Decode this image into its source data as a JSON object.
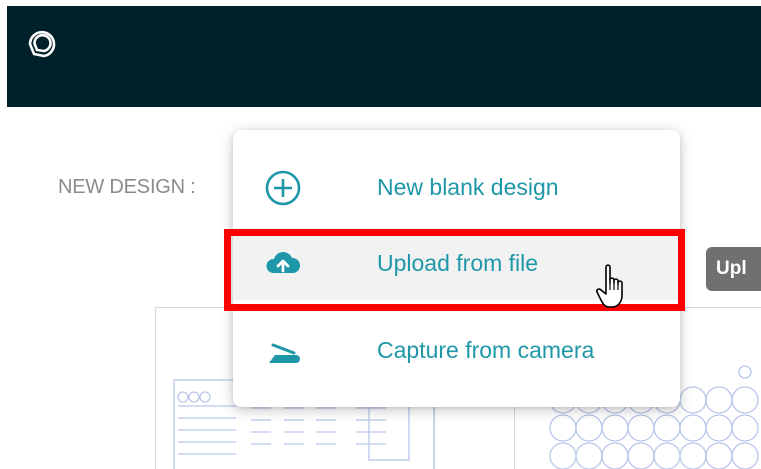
{
  "header": {
    "logo_icon": "pin-logo-icon"
  },
  "new_design": {
    "label": "NEW DESIGN :"
  },
  "side_chip": {
    "label": "Upl"
  },
  "menu": {
    "items": [
      {
        "label": "New blank design",
        "icon": "plus-circle-icon"
      },
      {
        "label": "Upload from file",
        "icon": "cloud-upload-icon",
        "highlighted": true
      },
      {
        "label": "Capture from camera",
        "icon": "scanner-icon"
      }
    ]
  },
  "colors": {
    "header_bg": "#00212a",
    "accent": "#1e97a8",
    "highlight_border": "#ff0000",
    "hover_bg": "#f2f2f2"
  }
}
